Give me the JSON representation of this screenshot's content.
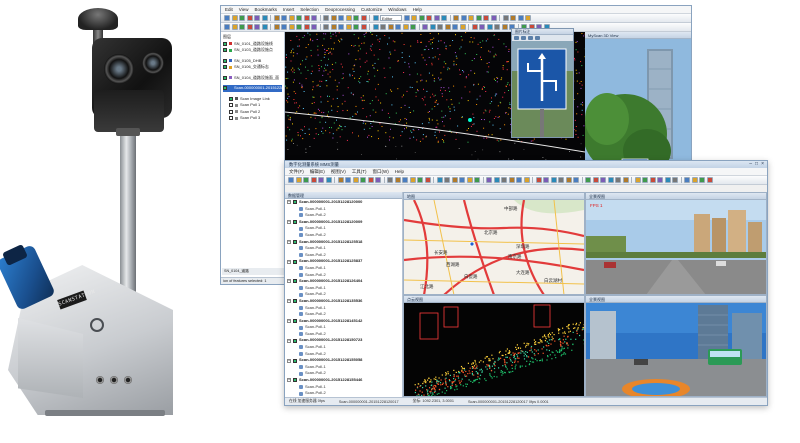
{
  "back_window": {
    "menu": [
      "Edit",
      "View",
      "Bookmarks",
      "Insert",
      "Selection",
      "Geoprocessing",
      "Customize",
      "Windows",
      "Help"
    ],
    "editor_label": "Editor",
    "toc_title": "图层",
    "toc_items": [
      {
        "label": "SN_0101_道路设施线",
        "checked": true,
        "color": "#d03030"
      },
      {
        "label": "SN_0103_道路设施点",
        "checked": true,
        "color": "#2aa84a"
      },
      {
        "label": "SN_0105_DHB",
        "checked": true,
        "color": "#3060c0"
      },
      {
        "label": "SN_0106_交通标志",
        "checked": true,
        "color": "#e0a020"
      },
      {
        "label": "SN_0104_道路设施面_面",
        "checked": true,
        "color": "#8a5cc0"
      },
      {
        "label": "Scan-000000001-20151228120000",
        "checked": true,
        "color": "#316ac5",
        "selected": true
      },
      {
        "label": "Scan Image Link",
        "checked": true,
        "color": "#555555"
      },
      {
        "label": "Scan Poll 1",
        "checked": false,
        "color": "#888888"
      },
      {
        "label": "Scan Poll 2",
        "checked": false,
        "color": "#888888"
      },
      {
        "label": "Scan Poll 3",
        "checked": false,
        "color": "#888888"
      }
    ],
    "popup_title": "图片标注",
    "view3d_title": "MyScan 3D View",
    "status": "ion of features selected: 1"
  },
  "side_strip": {
    "title": "Table",
    "rows": [
      "",
      "",
      "",
      "",
      "",
      "",
      ""
    ],
    "status": "SN_0104_道路"
  },
  "front_window": {
    "title": "数字化测量系统 MMS测量",
    "menu": [
      "文件(F)",
      "编辑(E)",
      "视图(V)",
      "工具(T)",
      "窗口(W)",
      "Help"
    ],
    "tree_title": "数据管理",
    "tree_groups": [
      {
        "label": "Scan-000000001-20151228120000",
        "children": [
          "Scan-Poll-1",
          "Scan-Poll-2"
        ]
      },
      {
        "label": "Scan-000000001-20151228120009",
        "children": [
          "Scan-Poll-1",
          "Scan-Poll-2"
        ]
      },
      {
        "label": "Scan-000000001-20151228125518",
        "children": [
          "Scan-Poll-1",
          "Scan-Poll-2"
        ]
      },
      {
        "label": "Scan-000000001-20151228125837",
        "children": [
          "Scan-Poll-1",
          "Scan-Poll-2"
        ]
      },
      {
        "label": "Scan-000000001-20151228126404",
        "children": [
          "Scan-Poll-1",
          "Scan-Poll-2"
        ]
      },
      {
        "label": "Scan-000000001-20151228135536",
        "children": [
          "Scan-Poll-1",
          "Scan-Poll-2"
        ]
      },
      {
        "label": "Scan-000000001-20151228145142",
        "children": [
          "Scan-Poll-1",
          "Scan-Poll-2"
        ]
      },
      {
        "label": "Scan-000000001-20151228150723",
        "children": [
          "Scan-Poll-1",
          "Scan-Poll-2"
        ]
      },
      {
        "label": "Scan-000000001-20151228155058",
        "children": [
          "Scan-Poll-1",
          "Scan-Poll-2"
        ]
      },
      {
        "label": "Scan-000000001-20151228155446",
        "children": [
          "Scan-Poll-1",
          "Scan-Poll-2"
        ]
      },
      {
        "label": "Scan-000000001-20151228155702",
        "children": [
          "Scan-Poll-1",
          "Scan-Poll-2"
        ]
      }
    ],
    "views": {
      "map": {
        "title": "地图",
        "labels": [
          "中部路",
          "北京路",
          "深圳路",
          "南京路",
          "长安路",
          "白瓷路",
          "大连路",
          "西湖路",
          "江北路",
          "白云湖村"
        ]
      },
      "photo_front": {
        "title": "全景视图",
        "fps": "FPS 1"
      },
      "pointcloud": {
        "title": "点云视图"
      },
      "photo_street": {
        "title": "全景视图"
      }
    },
    "status": [
      "在线  加速服务器 0fps",
      "Scan-000000001-20151228120017",
      "坐标: 1092.2301, 3.0001",
      "Scan-000000001-20151228120017  0fps  0.0001"
    ]
  },
  "device": {
    "label": "SCANSTATION"
  }
}
